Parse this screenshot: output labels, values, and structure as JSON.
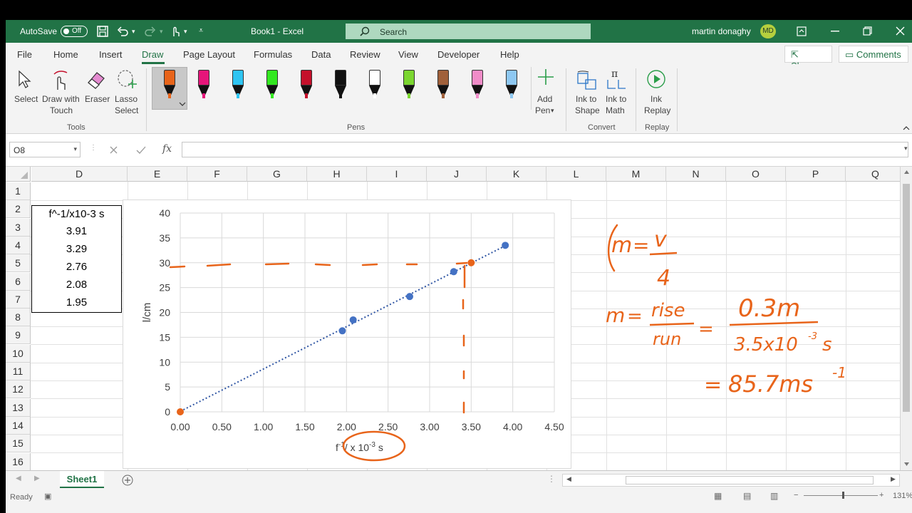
{
  "titlebar": {
    "autosave_label": "AutoSave",
    "autosave_state": "Off",
    "workbook_title": "Book1  -  Excel",
    "search_placeholder": "Search",
    "user_name": "martin donaghy",
    "user_initials": "MD"
  },
  "tabs": [
    "File",
    "Home",
    "Insert",
    "Draw",
    "Page Layout",
    "Formulas",
    "Data",
    "Review",
    "View",
    "Developer",
    "Help"
  ],
  "active_tab": "Draw",
  "share_label": "Share",
  "comments_label": "Comments",
  "ribbon": {
    "tools": {
      "select": "Select",
      "draw_touch_1": "Draw with",
      "draw_touch_2": "Touch",
      "eraser": "Eraser",
      "lasso_1": "Lasso",
      "lasso_2": "Select",
      "group": "Tools"
    },
    "pens_group": "Pens",
    "pen_colors": [
      "#e8641a",
      "#e6157a",
      "#2ec4f2",
      "#33e820",
      "#c4102b",
      "#111111",
      "#ffffff",
      "#7bd630",
      "#a0603a",
      "#f08cc8",
      "#8ec8f2"
    ],
    "add_pen_1": "Add",
    "add_pen_2": "Pen",
    "convert": {
      "ink_shape_1": "Ink to",
      "ink_shape_2": "Shape",
      "ink_math_1": "Ink to",
      "ink_math_2": "Math",
      "group": "Convert"
    },
    "replay": {
      "ink_replay_1": "Ink",
      "ink_replay_2": "Replay",
      "group": "Replay"
    }
  },
  "formula_bar": {
    "name_box": "O8",
    "fx": "fx",
    "value": ""
  },
  "columns": [
    "D",
    "E",
    "F",
    "G",
    "H",
    "I",
    "J",
    "K",
    "L",
    "M",
    "N",
    "O",
    "P",
    "Q"
  ],
  "rows": [
    "1",
    "2",
    "3",
    "4",
    "5",
    "6",
    "7",
    "8",
    "9",
    "10",
    "11",
    "12",
    "13",
    "14",
    "15",
    "16"
  ],
  "table": {
    "header": "f^-1/x10-3 s",
    "values": [
      "3.91",
      "3.29",
      "2.76",
      "2.08",
      "1.95"
    ]
  },
  "chart_data": {
    "type": "scatter",
    "x": [
      3.91,
      3.29,
      2.76,
      2.08,
      1.95
    ],
    "y": [
      33.5,
      28.2,
      23.2,
      18.5,
      16.3
    ],
    "xlim": [
      0,
      4.5
    ],
    "ylim": [
      0,
      40
    ],
    "xticks": [
      "0.00",
      "0.50",
      "1.00",
      "1.50",
      "2.00",
      "2.50",
      "3.00",
      "3.50",
      "4.00",
      "4.50"
    ],
    "yticks": [
      "0",
      "5",
      "10",
      "15",
      "20",
      "25",
      "30",
      "35",
      "40"
    ],
    "ylabel": "l/cm",
    "xlabel": "f",
    "xlabel_sup1": "-1",
    "xlabel_mid": "/ x 10",
    "xlabel_sup2": "-3",
    "xlabel_end": " s",
    "trendline": "dotted linear",
    "grid": true,
    "colors": {
      "points": "#4472c4",
      "trendline": "#2f55a3",
      "ink": "#e8641a"
    }
  },
  "ink_annotations": {
    "line1_left": "m",
    "line1_eq": "=",
    "line1_num": "v",
    "line1_den": "4",
    "line2_left": "m",
    "line2_eq": "=",
    "line2_frac_num": "rise",
    "line2_frac_den": "run",
    "line2_eq2": "=",
    "line2_value_num": "0.3m",
    "line2_value_den": "3.5x10",
    "line2_value_den_sup": "-3",
    "line2_value_den_end": "s",
    "line3_eq": "=",
    "line3_value": "85.7ms",
    "line3_sup": "-1"
  },
  "sheet_tab": "Sheet1",
  "status": {
    "ready": "Ready",
    "zoom": "131%"
  }
}
